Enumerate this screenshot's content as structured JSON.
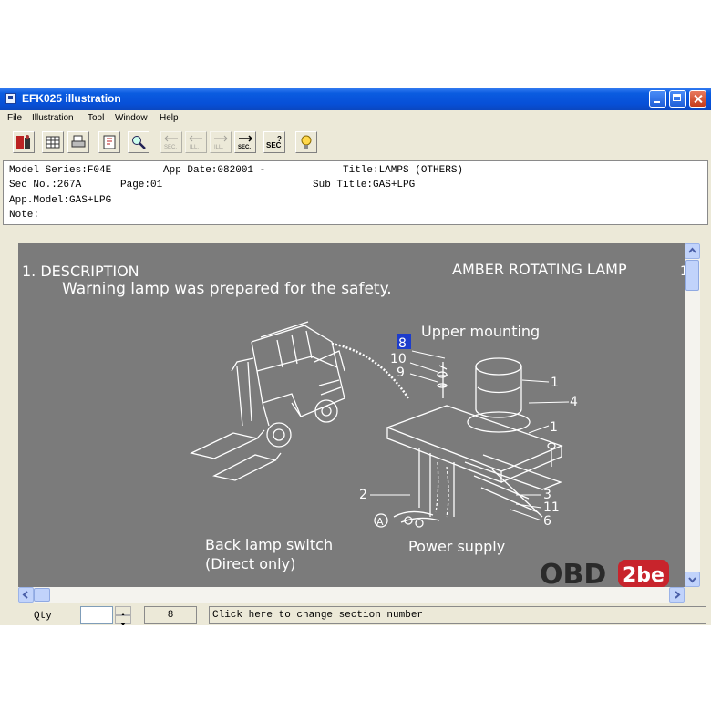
{
  "window": {
    "title": "EFK025 illustration"
  },
  "menu": [
    "File",
    "Illustration",
    "Tool",
    "Window",
    "Help"
  ],
  "toolbar": {
    "buttons": [
      {
        "icon": "exit-icon"
      },
      {
        "icon": "grid-icon"
      },
      {
        "icon": "print-icon"
      },
      {
        "icon": "book-icon"
      },
      {
        "icon": "magnifier-icon"
      },
      {
        "icon": "prev-section-icon",
        "label": "SEC."
      },
      {
        "icon": "prev-illustration-icon",
        "label": "ILL."
      },
      {
        "icon": "next-illustration-icon",
        "label": "ILL."
      },
      {
        "icon": "next-section-icon",
        "label": "SEC."
      },
      {
        "icon": "section-query-icon",
        "label": "SEC"
      },
      {
        "icon": "help-bulb-icon"
      }
    ]
  },
  "info": {
    "model_series": "Model Series:F04E",
    "app_date": "App Date:082001 -",
    "title": "Title:LAMPS (OTHERS)",
    "sec_no": "Sec No.:267A",
    "page": "Page:01",
    "sub_title": "Sub Title:GAS+LPG",
    "app_model": "App.Model:GAS+LPG",
    "note": "Note:"
  },
  "illustration": {
    "heading": "1. DESCRIPTION",
    "header_right": "AMBER ROTATING LAMP",
    "description": "Warning lamp was prepared for the safety.",
    "upper_mounting": "Upper mounting",
    "back_lamp_switch": "Back lamp switch",
    "direct_only": "(Direct only)",
    "power_supply": "Power supply",
    "callouts": [
      "8",
      "10",
      "9",
      "1",
      "4",
      "1",
      "2",
      "3",
      "11",
      "6",
      "A"
    ],
    "selected_callout": "8"
  },
  "status": {
    "qty_label": "Qty",
    "qty_value": "",
    "section_number": "8",
    "hint": "Click here to change section number"
  },
  "watermark": {
    "text_left": "OBD",
    "text_right": "2be"
  },
  "colors": {
    "titlebar": "#0a5ce0",
    "illustration_bg": "#7b7b7b",
    "line_art": "#ffffff",
    "selection": "#1c3ccc",
    "watermark_red": "#c8242c"
  }
}
